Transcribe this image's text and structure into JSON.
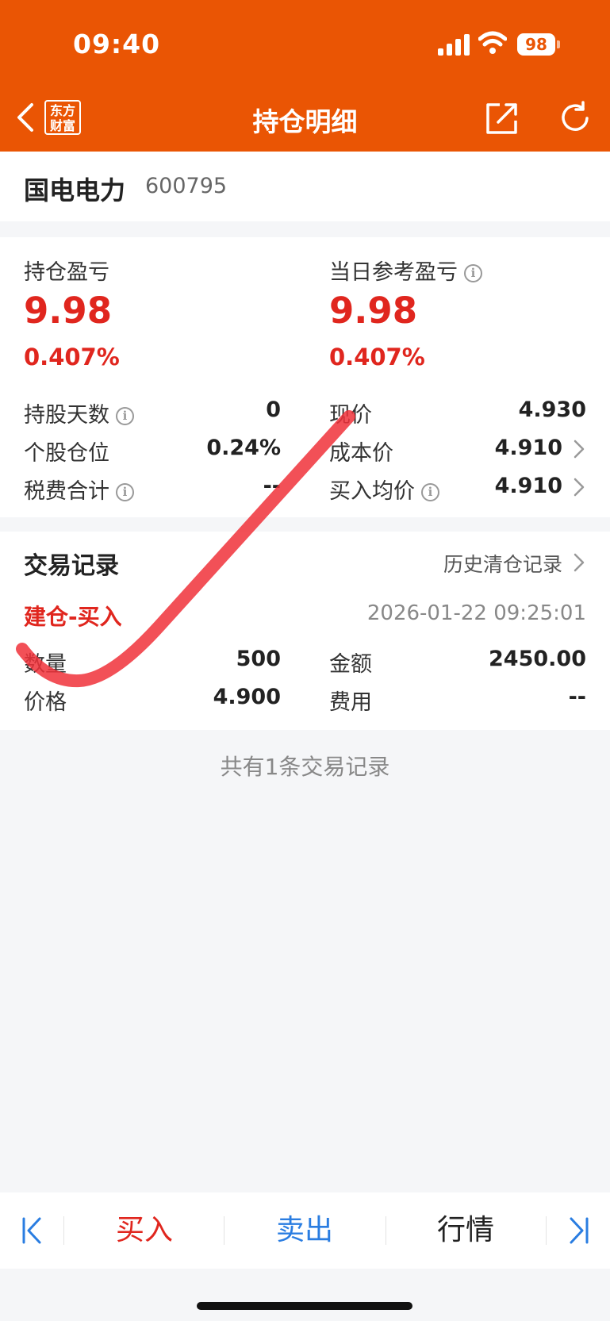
{
  "status": {
    "time": "09:40",
    "battery": "98"
  },
  "nav": {
    "logo_line1": "东方",
    "logo_line2": "财富",
    "title": "持仓明细"
  },
  "stock": {
    "name": "国电电力",
    "code": "600795"
  },
  "summary": {
    "holding_pl_label": "持仓盈亏",
    "holding_pl_value": "9.98",
    "holding_pl_pct": "0.407%",
    "daily_pl_label": "当日参考盈亏",
    "daily_pl_value": "9.98",
    "daily_pl_pct": "0.407%",
    "rows": [
      {
        "left_label": "持股天数",
        "left_value": "0",
        "right_label": "现价",
        "right_value": "4.930"
      },
      {
        "left_label": "个股仓位",
        "left_value": "0.24%",
        "right_label": "成本价",
        "right_value": "4.910"
      },
      {
        "left_label": "税费合计",
        "left_value": "--",
        "right_label": "买入均价",
        "right_value": "4.910"
      }
    ]
  },
  "records": {
    "title": "交易记录",
    "history_link": "历史清仓记录",
    "trade_type": "建仓-买入",
    "trade_time": "2026-01-22 09:25:01",
    "qty_label": "数量",
    "qty_value": "500",
    "amount_label": "金额",
    "amount_value": "2450.00",
    "price_label": "价格",
    "price_value": "4.900",
    "fee_label": "费用",
    "fee_value": "--",
    "count_note": "共有1条交易记录"
  },
  "bottom": {
    "buy": "买入",
    "sell": "卖出",
    "quote": "行情"
  },
  "colors": {
    "header": "#ea5504",
    "red": "#e0261e",
    "blue": "#2a7de1"
  },
  "icons": [
    "back-icon",
    "share-icon",
    "refresh-icon",
    "info-icon",
    "chevron-right-icon",
    "first-page-icon",
    "last-page-icon"
  ]
}
